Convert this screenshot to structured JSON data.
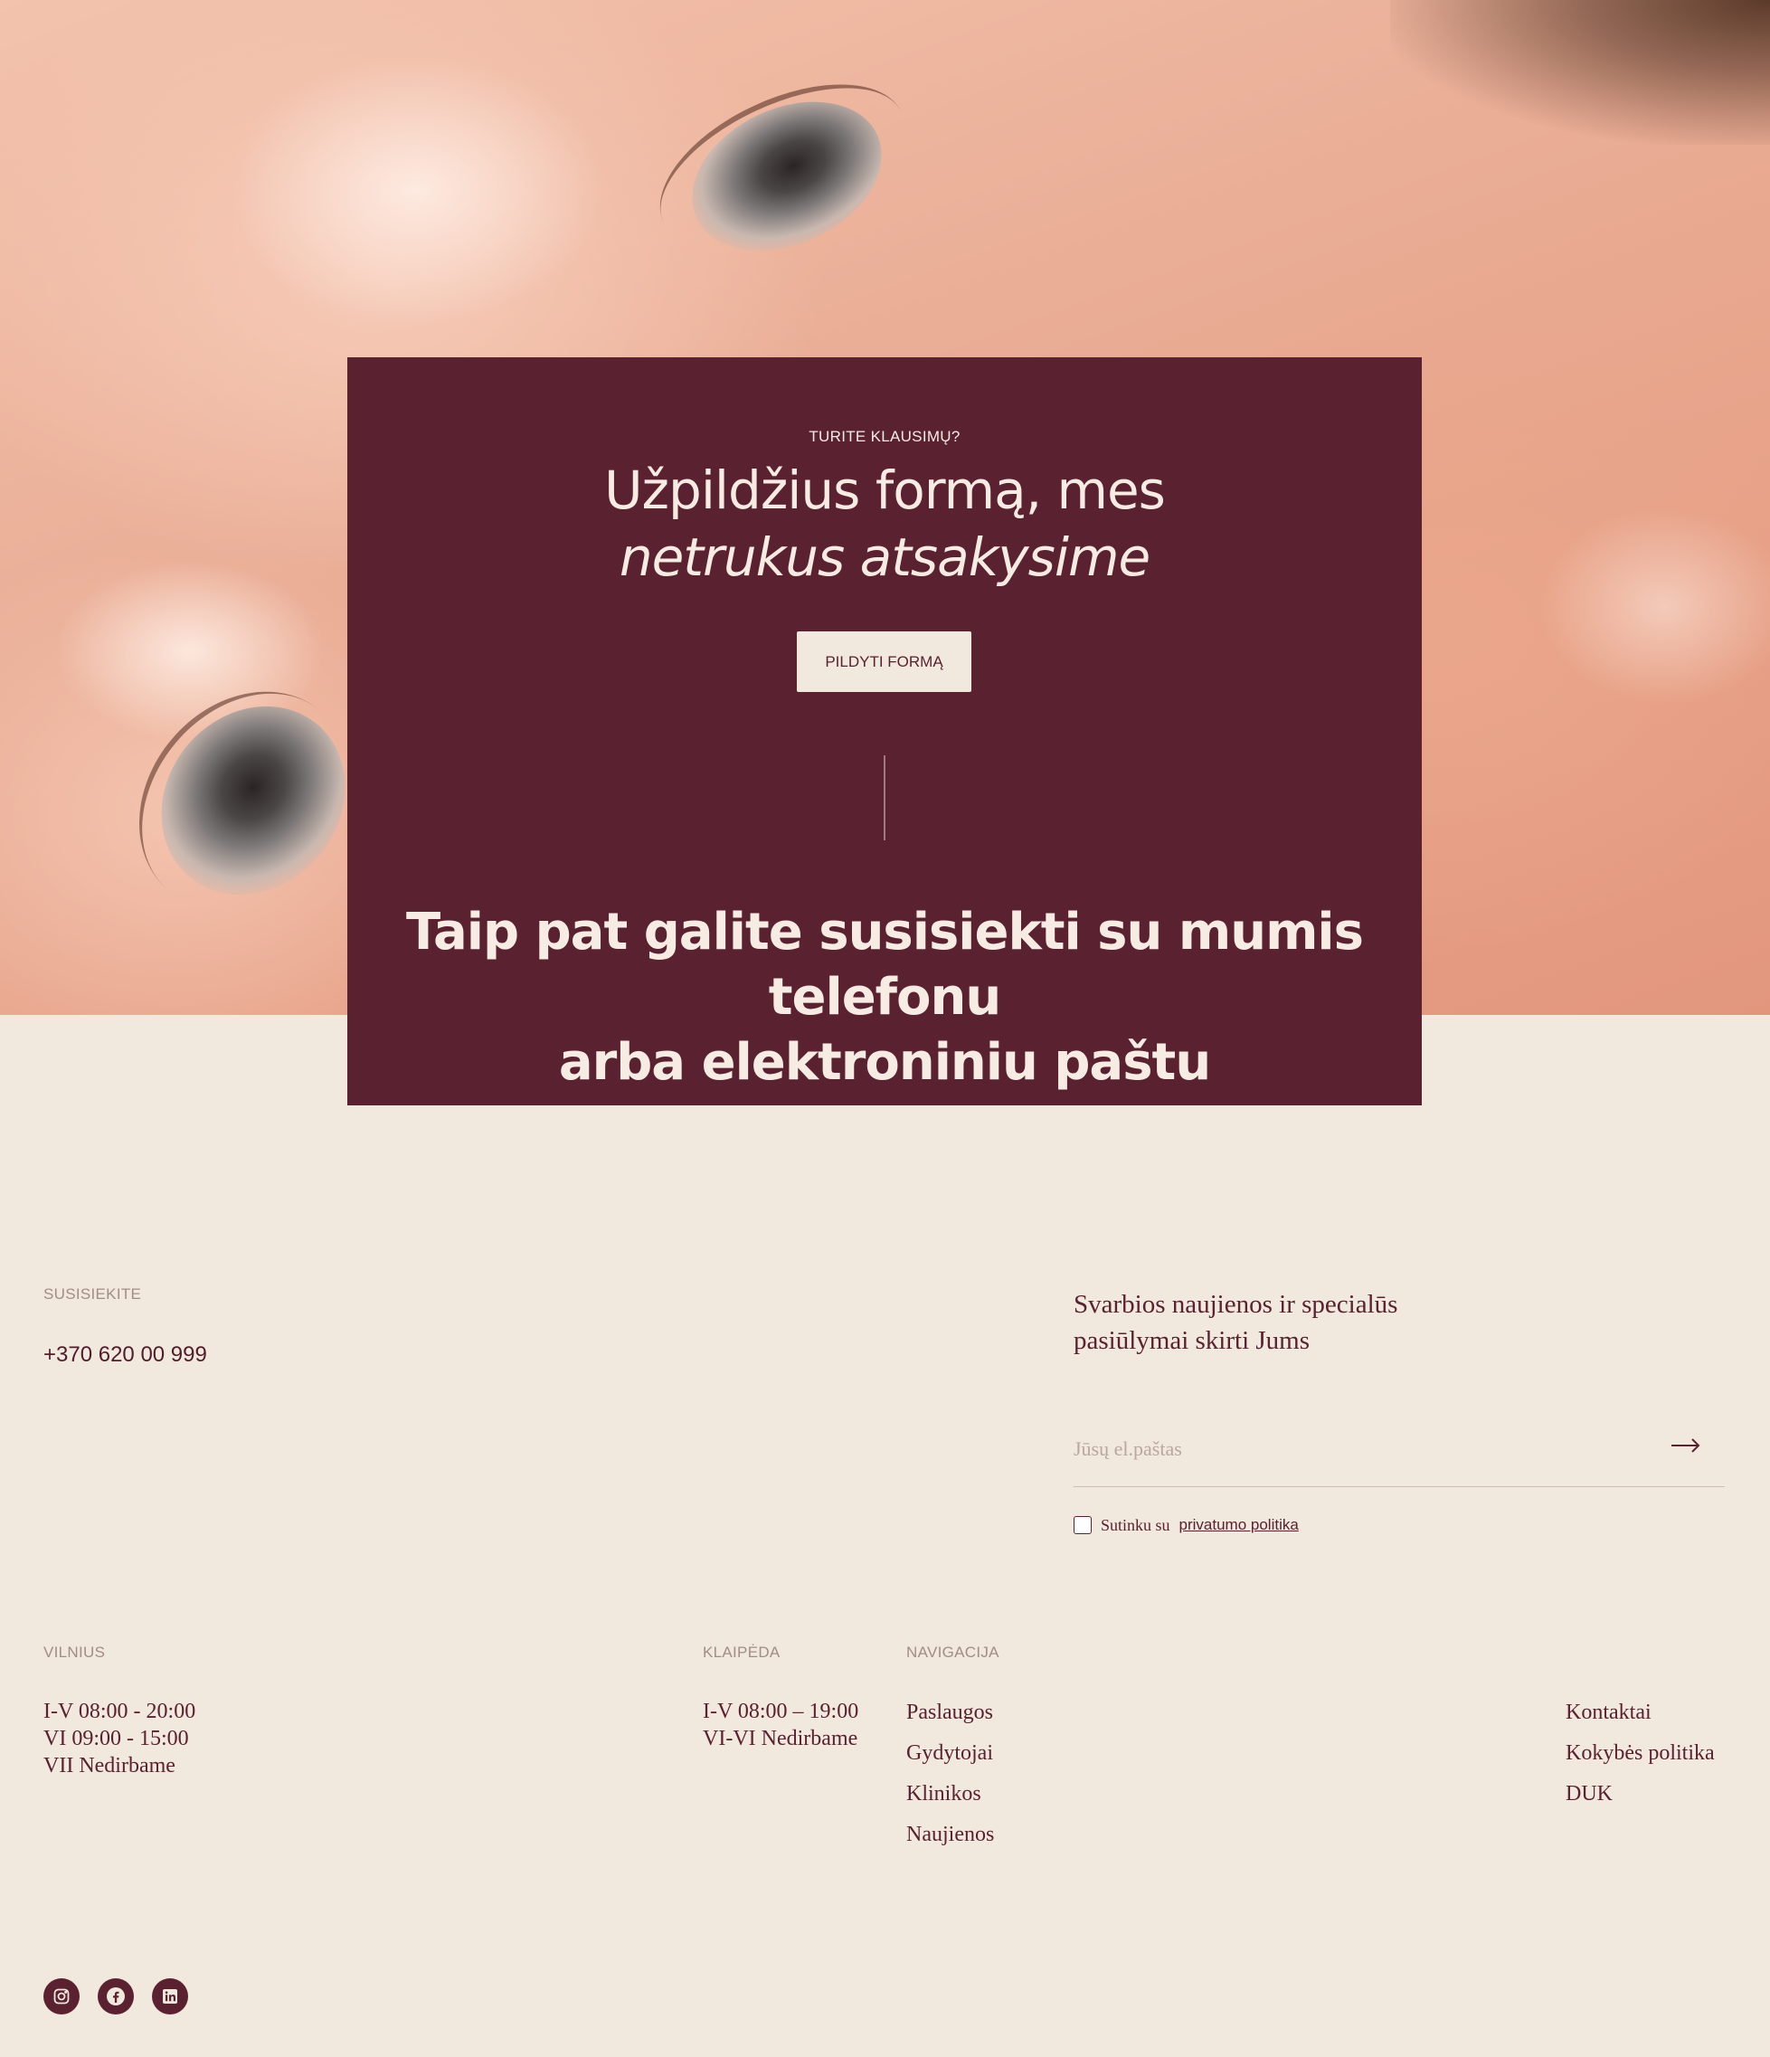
{
  "cta": {
    "eyebrow": "TURITE KLAUSIMŲ?",
    "headline_line1": "Užpildžius formą, mes",
    "headline_line2": "netrukus atsakysime",
    "button_label": "PILDYTI FORMĄ",
    "contact_line1": "Taip pat galite susisiekti su mumis telefonu",
    "contact_line2": "arba elektroniniu paštu"
  },
  "contact": {
    "label": "SUSISIEKITE",
    "phone": "+370 620 00 999"
  },
  "newsletter": {
    "title": "Svarbios naujienos ir specialūs pasiūlymai skirti Jums",
    "email_placeholder": "Jūsų el.paštas",
    "submit_icon": "arrow-right-icon",
    "consent_text": "Sutinku su",
    "consent_link": "privatumo politika"
  },
  "locations": {
    "vilnius": {
      "label": "VILNIUS",
      "lines": [
        "I-V 08:00 - 20:00",
        "VI 09:00 - 15:00",
        "VII Nedirbame"
      ]
    },
    "klaipeda": {
      "label": "KLAIPĖDA",
      "lines": [
        "I-V 08:00 – 19:00",
        "VI-VI Nedirbame"
      ]
    }
  },
  "navigation": {
    "label": "NAVIGACIJA",
    "col1": [
      "Paslaugos",
      "Gydytojai",
      "Klinikos",
      "Naujienos"
    ],
    "col2": [
      "Kontaktai",
      "Kokybės politika",
      "DUK"
    ]
  },
  "social": [
    "instagram-icon",
    "facebook-icon",
    "linkedin-icon"
  ],
  "colors": {
    "brand": "#5a2131",
    "background": "#f1e8de",
    "muted_label": "#a28c88"
  }
}
